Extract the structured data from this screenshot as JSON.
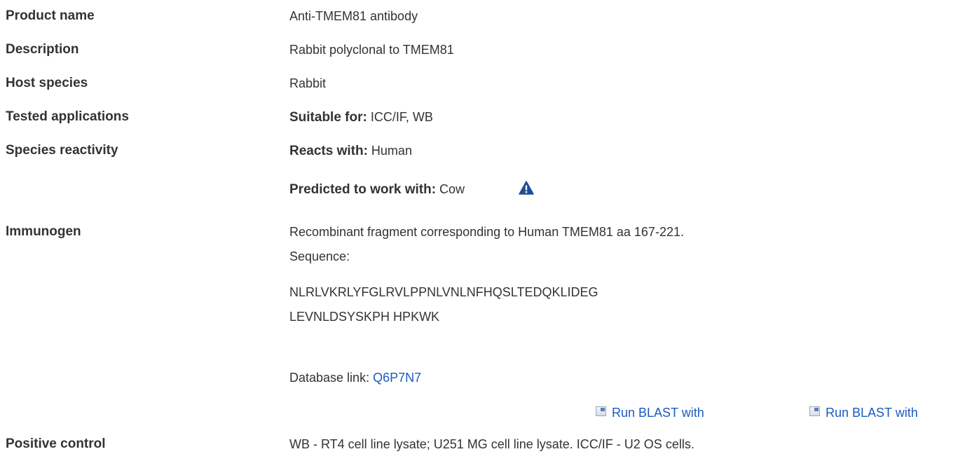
{
  "rows": {
    "product_name": {
      "label": "Product name",
      "value": "Anti-TMEM81 antibody"
    },
    "description": {
      "label": "Description",
      "value": "Rabbit polyclonal to TMEM81"
    },
    "host_species": {
      "label": "Host species",
      "value": "Rabbit"
    },
    "tested_applications": {
      "label": "Tested applications",
      "prefix": "Suitable for:",
      "value": " ICC/IF, WB"
    },
    "species_reactivity": {
      "label": "Species reactivity",
      "reacts_prefix": "Reacts with:",
      "reacts_value": " Human",
      "predicted_prefix": "Predicted to work with:",
      "predicted_value": " Cow",
      "warning_icon": "warning-triangle-icon"
    },
    "immunogen": {
      "label": "Immunogen",
      "description": "Recombinant fragment corresponding to Human TMEM81 aa 167-221.",
      "sequence_label": "Sequence:",
      "sequence_line1": "NLRLVKRLYFGLRVLPPNLVNLNFHQSLTEDQKLIDEG",
      "sequence_line2": "LEVNLDSYSKPH HPKWK",
      "database_prefix": "Database link: ",
      "database_link": "Q6P7N7",
      "blast_label_1": "Run BLAST with",
      "blast_label_2": "Run BLAST with"
    },
    "positive_control": {
      "label": "Positive control",
      "value": "WB - RT4 cell line lysate; U251 MG cell line lysate. ICC/IF - U2 OS cells."
    }
  },
  "colors": {
    "text": "#333333",
    "link": "#1a5bbf",
    "warning": "#1f4e96"
  }
}
